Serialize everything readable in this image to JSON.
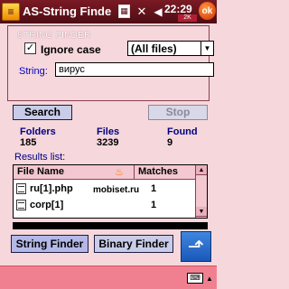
{
  "titlebar": {
    "logo_glyph": "≡",
    "app_title": "AS-String Finde",
    "calendar_icon_glyph": "▦",
    "signal_icon_glyph": "✕",
    "volume_icon_glyph": "◀",
    "clock": "22:29",
    "memory": "2K",
    "ok_label": "ok"
  },
  "finder": {
    "group_title": "STRING FINDER",
    "ignore_case_checked": true,
    "ignore_case_check_glyph": "✓",
    "ignore_case_label": "Ignore case",
    "file_filter_value": "(All files)",
    "dropdown_arrow": "▼",
    "string_label": "String:",
    "string_value": "вирус",
    "search_label": "Search",
    "stop_label": "Stop"
  },
  "stats": {
    "folders_label": "Folders",
    "folders_value": "185",
    "files_label": "Files",
    "files_value": "3239",
    "found_label": "Found",
    "found_value": "9"
  },
  "results": {
    "label": "Results list:",
    "col_name": "File Name",
    "col_matches": "Matches",
    "flame_glyph": "♨",
    "scroll_up": "▲",
    "scroll_down": "▼",
    "rows": [
      {
        "name": "ru[1].php",
        "matches": "1"
      },
      {
        "name": "corp[1]",
        "matches": "1"
      }
    ],
    "watermark": "mobiset.ru"
  },
  "tabs": {
    "string_finder": "String Finder",
    "binary_finder": "Binary Finder",
    "up_glyph": "⬏"
  },
  "softkeys": {
    "keyboard_glyph": "⌨",
    "keyboard_arrow": "▲"
  },
  "colors": {
    "titlebar": "#4e0c14",
    "background": "#f5d7dc",
    "button": "#c8cce8",
    "softkey_bar": "#f08090",
    "accent_blue": "#1a58b8"
  }
}
